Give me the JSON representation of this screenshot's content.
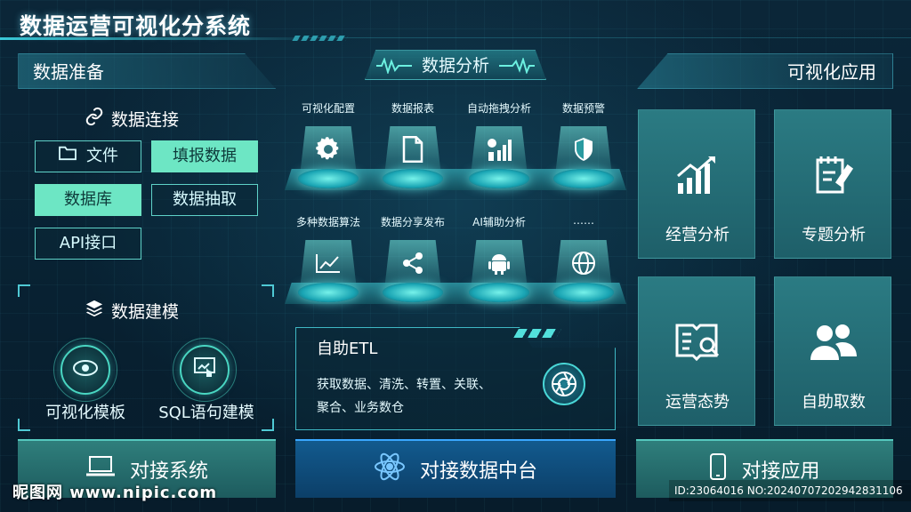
{
  "app": {
    "title": "数据运营可视化分系统"
  },
  "left": {
    "header": "数据准备",
    "connect": {
      "title": "数据连接",
      "buttons": [
        {
          "label": "文件",
          "active": false,
          "icon": "folder-icon"
        },
        {
          "label": "填报数据",
          "active": true
        },
        {
          "label": "数据库",
          "active": true
        },
        {
          "label": "数据抽取",
          "active": false
        },
        {
          "label": "API接口",
          "active": false
        }
      ]
    },
    "modeling": {
      "title": "数据建模",
      "items": [
        {
          "label": "可视化模板",
          "icon": "eye-icon"
        },
        {
          "label": "SQL语句建模",
          "icon": "touch-screen-icon"
        }
      ]
    },
    "bottom": {
      "label": "对接系统",
      "icon": "laptop-icon"
    }
  },
  "center": {
    "header": "数据分析",
    "row1": [
      {
        "label": "可视化配置",
        "icon": "gear-icon"
      },
      {
        "label": "数据报表",
        "icon": "document-icon"
      },
      {
        "label": "自动拖拽分析",
        "icon": "bar-gear-icon"
      },
      {
        "label": "数据预警",
        "icon": "shield-icon"
      }
    ],
    "row2": [
      {
        "label": "多种数据算法",
        "icon": "trend-chart-icon"
      },
      {
        "label": "数据分享发布",
        "icon": "share-icon"
      },
      {
        "label": "AI辅助分析",
        "icon": "android-icon"
      },
      {
        "label": "……",
        "icon": "globe-icon"
      }
    ],
    "etl": {
      "title": "自助ETL",
      "line1": "获取数据、清洗、转置、关联、",
      "line2": "聚合、业务数仓"
    },
    "bottom": {
      "label": "对接数据中台",
      "icon": "atom-icon"
    }
  },
  "right": {
    "header": "可视化应用",
    "tiles": [
      {
        "label": "经营分析",
        "icon": "growth-chart-icon"
      },
      {
        "label": "专题分析",
        "icon": "notepad-pen-icon"
      },
      {
        "label": "运营态势",
        "icon": "book-search-icon"
      },
      {
        "label": "自助取数",
        "icon": "users-icon"
      }
    ],
    "bottom": {
      "label": "对接应用",
      "icon": "phone-icon"
    }
  },
  "watermark": {
    "left": "昵图网 www.nipic.com",
    "right": "ID:23064016 NO:20240707202942831106"
  },
  "colors": {
    "accent": "#6de6c4",
    "cyan": "#49d6c2",
    "tile": "#2b7b83",
    "center_bar": "#125a8e"
  }
}
